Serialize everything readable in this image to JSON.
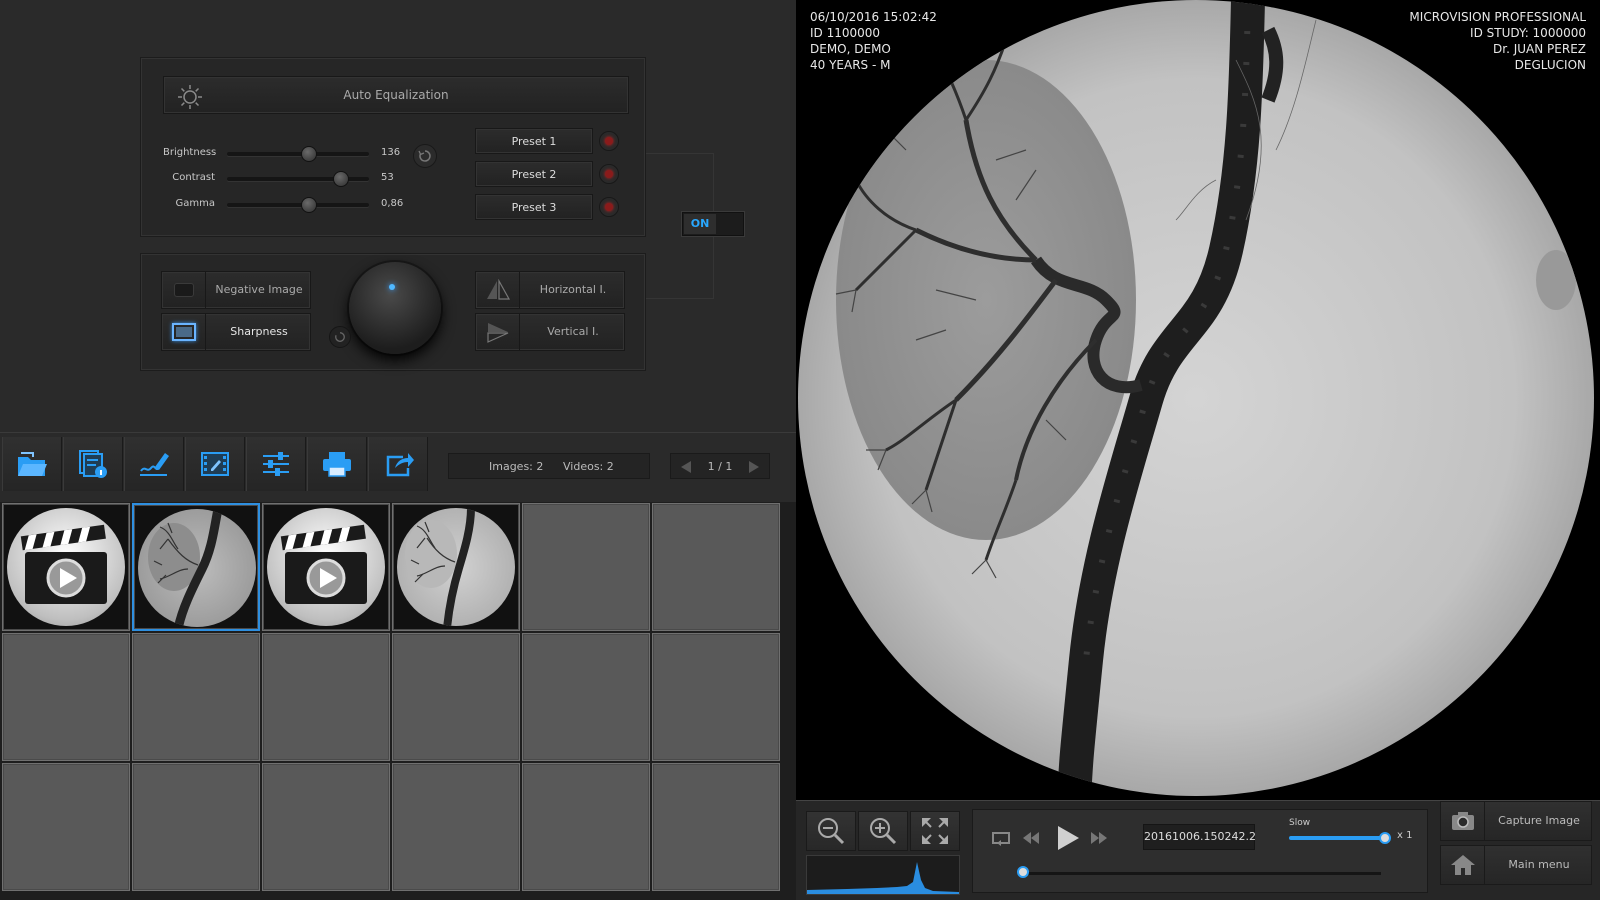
{
  "equalization": {
    "auto_label": "Auto Equalization",
    "sliders": [
      {
        "name": "Brightness",
        "value": "136"
      },
      {
        "name": "Contrast",
        "value": "53"
      },
      {
        "name": "Gamma",
        "value": "0,86"
      }
    ],
    "presets": [
      "Preset 1",
      "Preset 2",
      "Preset 3"
    ],
    "toggle_label": "ON"
  },
  "effects": {
    "negative_label": "Negative Image",
    "sharpness_label": "Sharpness",
    "horizontal_label": "Horizontal I.",
    "vertical_label": "Vertical I."
  },
  "toolbar": {
    "images_label": "Images: 2",
    "videos_label": "Videos: 2",
    "page": "1 / 1"
  },
  "viewer": {
    "left_info": [
      "06/10/2016 15:02:42",
      "ID 1100000",
      "DEMO, DEMO",
      "40 YEARS - M"
    ],
    "right_info": [
      "MICROVISION PROFESSIONAL",
      "ID STUDY:  1000000",
      "Dr. JUAN PEREZ",
      "DEGLUCION"
    ]
  },
  "player": {
    "timestamp": "20161006.150242.2",
    "speed_label": "Slow",
    "speed_mult": "x 1"
  },
  "side_buttons": {
    "capture_label": "Capture Image",
    "main_menu_label": "Main menu"
  },
  "colors": {
    "accent": "#2a9df4",
    "record": "#8a1b1b"
  }
}
